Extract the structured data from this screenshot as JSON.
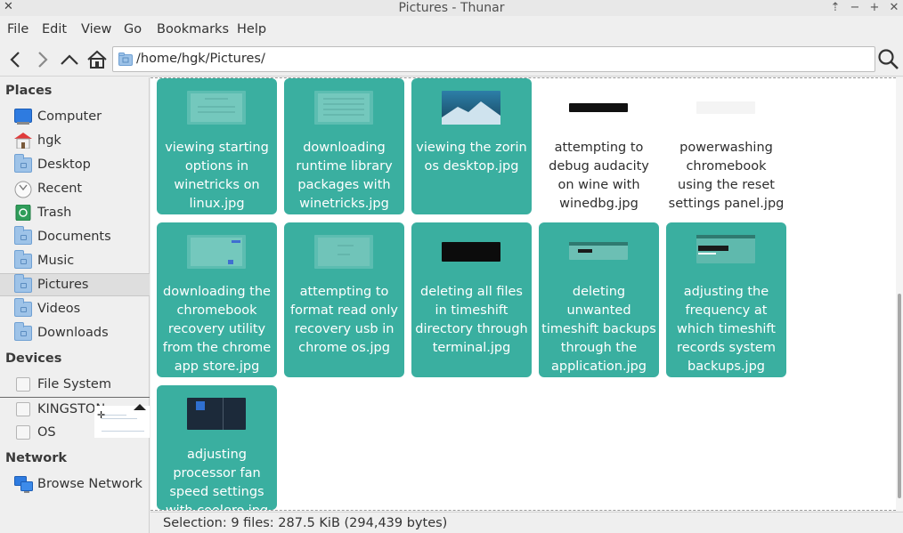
{
  "window": {
    "title": "Pictures - Thunar"
  },
  "menubar": {
    "items": [
      "File",
      "Edit",
      "View",
      "Go",
      "Bookmarks",
      "Help"
    ]
  },
  "location": {
    "path": "/home/hgk/Pictures/"
  },
  "sidebar": {
    "places_header": "Places",
    "places": [
      {
        "label": "Computer",
        "icon": "computer-icon"
      },
      {
        "label": "hgk",
        "icon": "home-icon"
      },
      {
        "label": "Desktop",
        "icon": "folder-icon"
      },
      {
        "label": "Recent",
        "icon": "recent-icon"
      },
      {
        "label": "Trash",
        "icon": "trash-icon"
      },
      {
        "label": "Documents",
        "icon": "folder-icon"
      },
      {
        "label": "Music",
        "icon": "folder-icon"
      },
      {
        "label": "Pictures",
        "icon": "folder-icon",
        "selected": true
      },
      {
        "label": "Videos",
        "icon": "folder-icon"
      },
      {
        "label": "Downloads",
        "icon": "folder-icon"
      }
    ],
    "devices_header": "Devices",
    "devices": [
      {
        "label": "File System",
        "icon": "drive-icon"
      },
      {
        "label": "KINGSTON",
        "icon": "drive-icon"
      },
      {
        "label": "OS",
        "icon": "drive-icon"
      }
    ],
    "network_header": "Network",
    "network": [
      {
        "label": "Browse Network",
        "icon": "network-icon"
      }
    ]
  },
  "files": [
    {
      "name": "viewing starting options in winetricks on linux.jpg",
      "selected": true
    },
    {
      "name": "downloading runtime library packages with winetricks.jpg",
      "selected": true
    },
    {
      "name": "viewing the zorin os desktop.jpg",
      "selected": true
    },
    {
      "name": "attempting to debug audacity on wine with winedbg.jpg",
      "selected": false
    },
    {
      "name": "powerwashing chromebook using the reset settings panel.jpg",
      "selected": false
    },
    {
      "name": "downloading the chromebook recovery utility from the chrome app store.jpg",
      "selected": true
    },
    {
      "name": "attempting to format read only recovery usb in chrome os.jpg",
      "selected": true
    },
    {
      "name": "deleting all files in timeshift directory through terminal.jpg",
      "selected": true
    },
    {
      "name": "deleting unwanted timeshift backups through the application.jpg",
      "selected": true
    },
    {
      "name": "adjusting the frequency at which timeshift records system backups.jpg",
      "selected": true
    },
    {
      "name": "adjusting processor fan speed settings with coolero.jpg",
      "selected": true
    }
  ],
  "status": {
    "text": "Selection: 9 files: 287.5 KiB (294,439 bytes)"
  },
  "colors": {
    "selection": "#3aafa0"
  }
}
